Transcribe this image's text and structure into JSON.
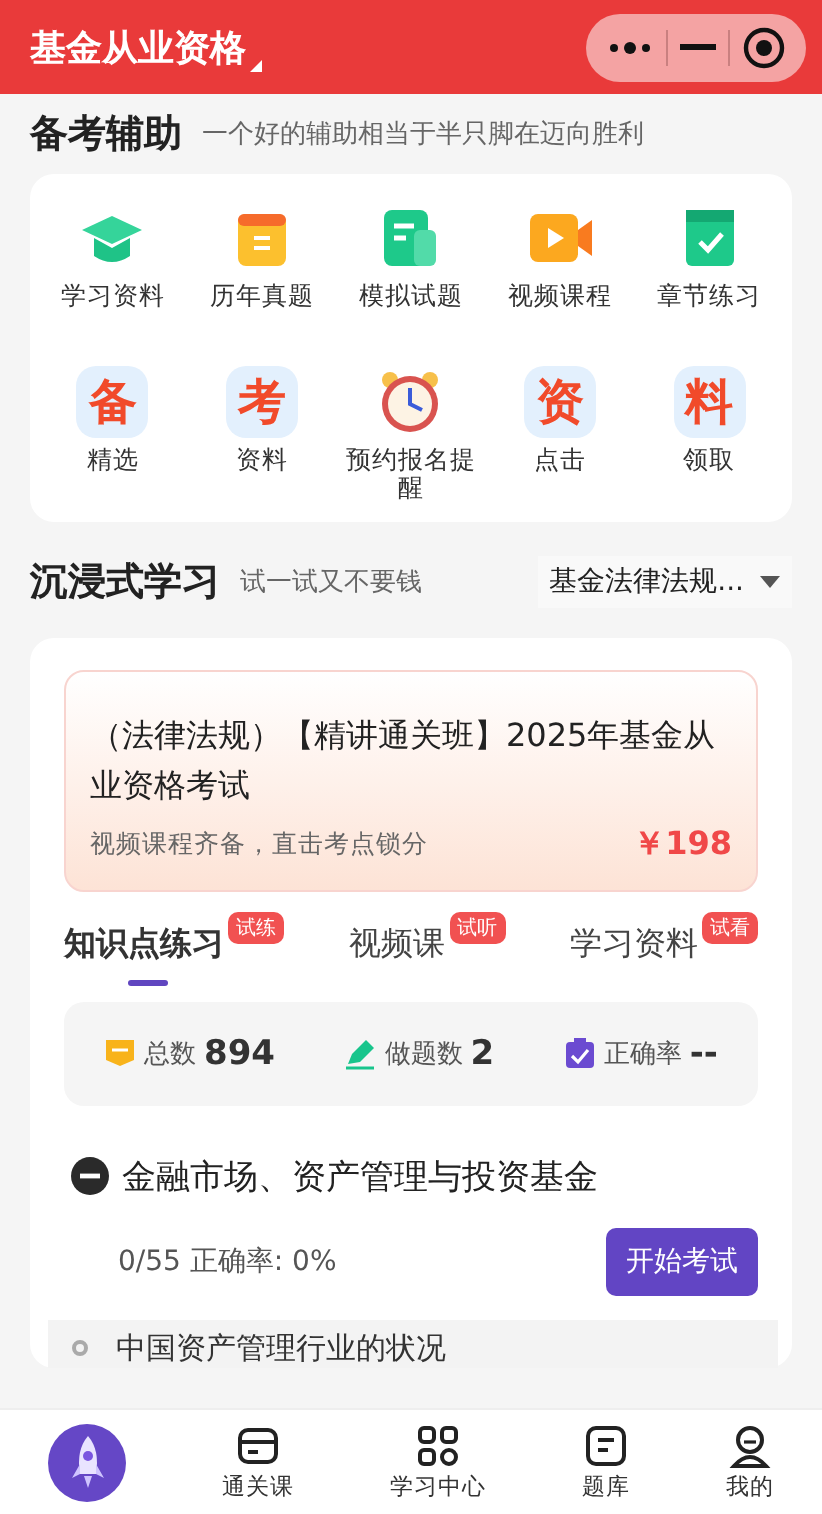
{
  "header": {
    "title": "基金从业资格"
  },
  "assist": {
    "title": "备考辅助",
    "subtitle": "一个好的辅助相当于半只脚在迈向胜利",
    "items": [
      {
        "kind": "icon",
        "label": "学习资料"
      },
      {
        "kind": "icon",
        "label": "历年真题"
      },
      {
        "kind": "icon",
        "label": "模拟试题"
      },
      {
        "kind": "icon",
        "label": "视频课程"
      },
      {
        "kind": "icon",
        "label": "章节练习"
      },
      {
        "kind": "glyph",
        "glyph": "备",
        "label": "精选"
      },
      {
        "kind": "glyph",
        "glyph": "考",
        "label": "资料"
      },
      {
        "kind": "icon",
        "label": "预约报名提醒"
      },
      {
        "kind": "glyph",
        "glyph": "资",
        "label": "点击"
      },
      {
        "kind": "glyph",
        "glyph": "料",
        "label": "领取"
      }
    ]
  },
  "immersive": {
    "title": "沉浸式学习",
    "subtitle": "试一试又不要钱",
    "dropdown": "基金法律法规...",
    "course": {
      "title": "（法律法规）【精讲通关班】2025年基金从业资格考试",
      "desc": "视频课程齐备，直击考点锁分",
      "price": "￥198"
    },
    "tabs": [
      {
        "label": "知识点练习",
        "badge": "试练",
        "selected": true
      },
      {
        "label": "视频课",
        "badge": "试听",
        "selected": false
      },
      {
        "label": "学习资料",
        "badge": "试看",
        "selected": false
      }
    ],
    "stats": [
      {
        "label": "总数",
        "value": "894"
      },
      {
        "label": "做题数",
        "value": "2"
      },
      {
        "label": "正确率",
        "value": "--"
      }
    ],
    "chapter": {
      "title": "金融市场、资产管理与投资基金",
      "expanded": true,
      "progress": "0/55  正确率: 0%",
      "button": "开始考试",
      "children": [
        {
          "title": "中国资产管理行业的状况"
        }
      ]
    }
  },
  "nav": [
    {
      "kind": "rocket"
    },
    {
      "kind": "tab",
      "label": "通关课"
    },
    {
      "kind": "tab",
      "label": "学习中心"
    },
    {
      "kind": "tab",
      "label": "题库"
    },
    {
      "kind": "tab",
      "label": "我的"
    }
  ]
}
